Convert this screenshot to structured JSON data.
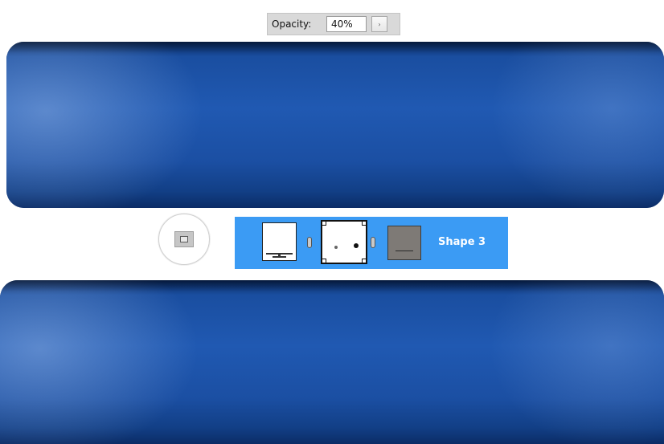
{
  "opacity": {
    "label": "Opacity:",
    "value": "40%",
    "arrow": "›"
  },
  "layer": {
    "name": "Shape 3"
  },
  "colors": {
    "bar_blue": "#1b4fa3",
    "layer_highlight": "#3b9bf4",
    "panel_gray": "#d9d9d9"
  },
  "icons": {
    "mask_button": "layer-mask-icon",
    "link": "chain-link-icon"
  }
}
